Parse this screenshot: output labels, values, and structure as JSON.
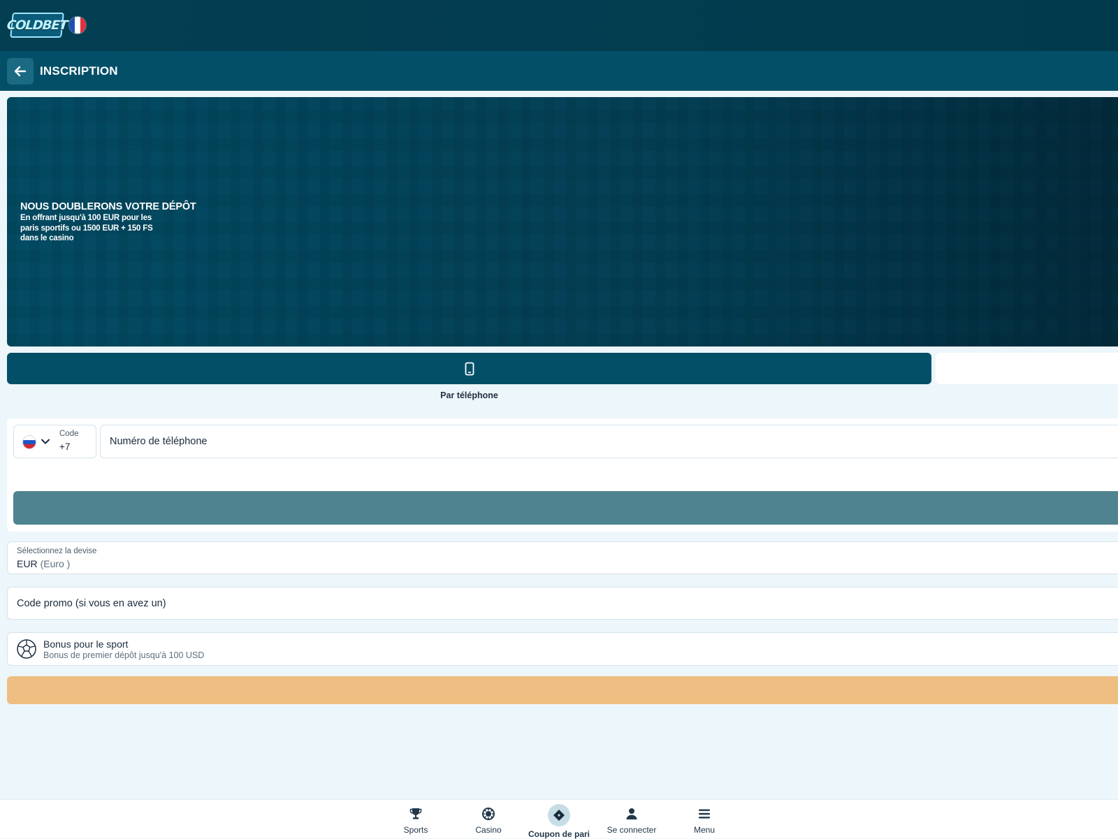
{
  "header": {
    "logo_text": "COLDBET",
    "language_flag_icon": "flag-france-icon"
  },
  "titlebar": {
    "back_icon": "arrow-left-icon",
    "title": "INSCRIPTION"
  },
  "banner": {
    "headline": "NOUS DOUBLERONS VOTRE DÉPÔT",
    "subtext": "En offrant jusqu'à 100 EUR pour les paris sportifs ou 1500 EUR + 150 FS dans le casino"
  },
  "registration_methods": {
    "active_icon": "mobile-phone-icon",
    "active_label": "Par téléphone"
  },
  "phone_form": {
    "country_flag_icon": "flag-russia-icon",
    "code_caption": "Code",
    "code_value": "+7",
    "phone_placeholder": "Numéro de téléphone"
  },
  "currency": {
    "caption": "Sélectionnez la devise",
    "code": "EUR",
    "name": "(Euro )"
  },
  "promo": {
    "placeholder": "Code promo (si vous en avez un)"
  },
  "bonus": {
    "icon": "soccer-ball-icon",
    "title": "Bonus pour le sport",
    "subtitle": "Bonus de premier dépôt jusqu'à 100 USD"
  },
  "colors": {
    "topbar": "#033e52",
    "titlebar": "#034f68",
    "send_button": "#508390",
    "register_button": "#efbe82",
    "page_background": "#ecf6fb"
  },
  "bottom_nav": {
    "items": [
      {
        "label": "Sports",
        "icon": "trophy-icon",
        "active": false
      },
      {
        "label": "Casino",
        "icon": "casino-chip-icon",
        "active": false
      },
      {
        "label": "Coupon de pari",
        "icon": "ticket-icon",
        "active": true
      },
      {
        "label": "Se connecter",
        "icon": "user-icon",
        "active": false
      },
      {
        "label": "Menu",
        "icon": "hamburger-menu-icon",
        "active": false
      }
    ]
  }
}
